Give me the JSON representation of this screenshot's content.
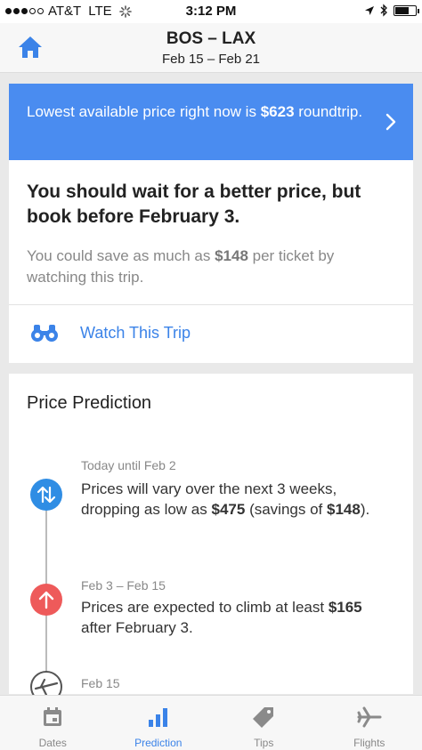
{
  "status_bar": {
    "carrier": "AT&T",
    "network": "LTE",
    "time": "3:12 PM",
    "signal_bars": 3
  },
  "header": {
    "route": "BOS – LAX",
    "dates": "Feb 15 – Feb 21",
    "home_icon": "home-icon"
  },
  "banner": {
    "text_prefix": "Lowest available price right now is",
    "price": "$623",
    "text_suffix": "roundtrip.",
    "bg_color": "#4a8cf0"
  },
  "advice": {
    "title": "You should wait for a better price, but book before February 3.",
    "sub_prefix": "You could save as much as",
    "savings": "$148",
    "sub_suffix": "per ticket by watching this trip.",
    "watch_label": "Watch This Trip",
    "watch_icon": "binoculars-icon"
  },
  "prediction": {
    "heading": "Price Prediction",
    "steps": [
      {
        "date": "Today until Feb 2",
        "text_a": "Prices will vary over the next 3 weeks, dropping as low as",
        "bold_a": "$475",
        "text_b": "(savings of",
        "bold_b": "$148",
        "text_c": ").",
        "icon": "up-down-arrows-icon",
        "color": "#2f8de4"
      },
      {
        "date": "Feb 3 – Feb 15",
        "text_a": "Prices are expected to climb at least",
        "bold_a": "$165",
        "text_b": "after February 3.",
        "icon": "arrow-up-icon",
        "color": "#ee5a5a"
      },
      {
        "date": "Feb 15",
        "icon": "plane-icon",
        "color": "#555555"
      }
    ]
  },
  "tabs": [
    {
      "label": "Dates",
      "icon": "calendar-icon",
      "active": false
    },
    {
      "label": "Prediction",
      "icon": "bar-chart-icon",
      "active": true
    },
    {
      "label": "Tips",
      "icon": "tag-icon",
      "active": false
    },
    {
      "label": "Flights",
      "icon": "plane-icon",
      "active": false
    }
  ]
}
